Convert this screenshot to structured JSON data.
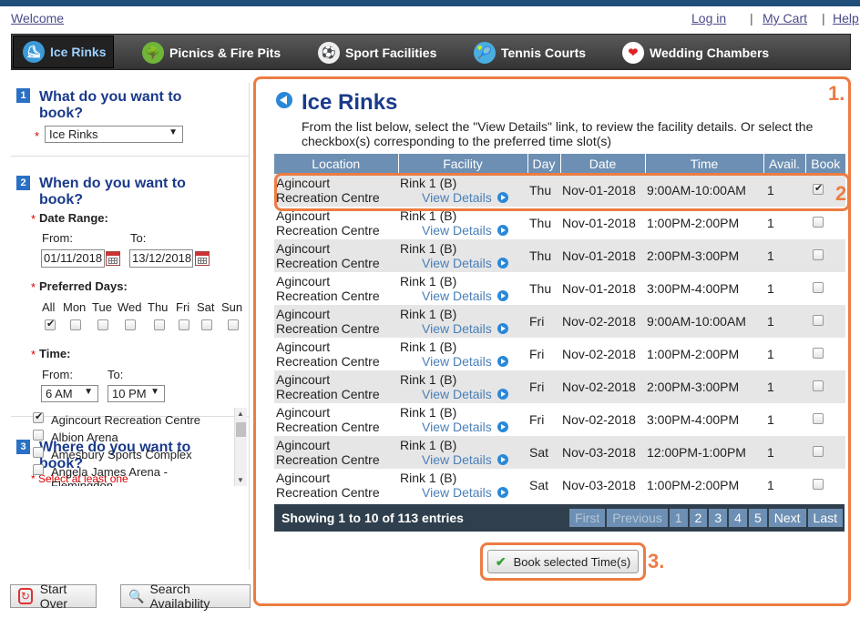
{
  "header": {
    "welcome": "Welcome",
    "login": "Log in",
    "cart": "My Cart",
    "help": "Help",
    "sep": "|"
  },
  "nav": {
    "tabs": [
      {
        "label": "Ice Rinks",
        "icon": "skate-icon",
        "active": true
      },
      {
        "label": "Picnics & Fire Pits",
        "icon": "picnic-icon"
      },
      {
        "label": "Sport Facilities",
        "icon": "soccer-ball-icon"
      },
      {
        "label": "Tennis Courts",
        "icon": "tennis-icon"
      },
      {
        "label": "Wedding Chambers",
        "icon": "heart-icon"
      }
    ]
  },
  "sidebar": {
    "step1": {
      "num": "1",
      "title": "What do you want to book?",
      "req": "*",
      "selected": "Ice Rinks"
    },
    "step2": {
      "num": "2",
      "title": "When do you want to book?",
      "date_range_label": "Date Range:",
      "from_label": "From:",
      "to_label": "To:",
      "from_value": "01/11/2018",
      "to_value": "13/12/2018",
      "days_label": "Preferred Days:",
      "days": [
        "All",
        "Mon",
        "Tue",
        "Wed",
        "Thu",
        "Fri",
        "Sat",
        "Sun"
      ],
      "days_checked": [
        true,
        false,
        false,
        false,
        false,
        false,
        false,
        false
      ],
      "time_label": "Time:",
      "time_from_label": "From:",
      "time_to_label": "To:",
      "time_from": "6 AM",
      "time_to": "10 PM",
      "req": "*"
    },
    "step3": {
      "num": "3",
      "title": "Where do you want to book?",
      "hint": "* Select at least one",
      "venues": [
        {
          "name": "Agincourt Recreation Centre",
          "checked": true
        },
        {
          "name": "Albion Arena",
          "checked": false
        },
        {
          "name": "Amesbury Sports Complex",
          "checked": false
        },
        {
          "name": "Angela James Arena - Flemingdon",
          "checked": false
        }
      ]
    },
    "start_over": "Start Over",
    "search": "Search Availability"
  },
  "main": {
    "title": "Ice Rinks",
    "intro": "From the list below, select the \"View Details\" link, to review the facility details. Or select the checkbox(s) corresponding to the preferred time slot(s)",
    "columns": [
      "Location",
      "Facility",
      "Day",
      "Date",
      "Time",
      "Avail.",
      "Book"
    ],
    "view_details": "View Details",
    "rows": [
      {
        "loc1": "Agincourt",
        "loc2": "Recreation Centre",
        "facility": "Rink 1 (B)",
        "day": "Thu",
        "date": "Nov-01-2018",
        "time": "9:00AM-10:00AM",
        "avail": "1",
        "book": true
      },
      {
        "loc1": "Agincourt",
        "loc2": "Recreation Centre",
        "facility": "Rink 1 (B)",
        "day": "Thu",
        "date": "Nov-01-2018",
        "time": "1:00PM-2:00PM",
        "avail": "1",
        "book": false
      },
      {
        "loc1": "Agincourt",
        "loc2": "Recreation Centre",
        "facility": "Rink 1 (B)",
        "day": "Thu",
        "date": "Nov-01-2018",
        "time": "2:00PM-3:00PM",
        "avail": "1",
        "book": false
      },
      {
        "loc1": "Agincourt",
        "loc2": "Recreation Centre",
        "facility": "Rink 1 (B)",
        "day": "Thu",
        "date": "Nov-01-2018",
        "time": "3:00PM-4:00PM",
        "avail": "1",
        "book": false
      },
      {
        "loc1": "Agincourt",
        "loc2": "Recreation Centre",
        "facility": "Rink 1 (B)",
        "day": "Fri",
        "date": "Nov-02-2018",
        "time": "9:00AM-10:00AM",
        "avail": "1",
        "book": false
      },
      {
        "loc1": "Agincourt",
        "loc2": "Recreation Centre",
        "facility": "Rink 1 (B)",
        "day": "Fri",
        "date": "Nov-02-2018",
        "time": "1:00PM-2:00PM",
        "avail": "1",
        "book": false
      },
      {
        "loc1": "Agincourt",
        "loc2": "Recreation Centre",
        "facility": "Rink 1 (B)",
        "day": "Fri",
        "date": "Nov-02-2018",
        "time": "2:00PM-3:00PM",
        "avail": "1",
        "book": false
      },
      {
        "loc1": "Agincourt",
        "loc2": "Recreation Centre",
        "facility": "Rink 1 (B)",
        "day": "Fri",
        "date": "Nov-02-2018",
        "time": "3:00PM-4:00PM",
        "avail": "1",
        "book": false
      },
      {
        "loc1": "Agincourt",
        "loc2": "Recreation Centre",
        "facility": "Rink 1 (B)",
        "day": "Sat",
        "date": "Nov-03-2018",
        "time": "12:00PM-1:00PM",
        "avail": "1",
        "book": false
      },
      {
        "loc1": "Agincourt",
        "loc2": "Recreation Centre",
        "facility": "Rink 1 (B)",
        "day": "Sat",
        "date": "Nov-03-2018",
        "time": "1:00PM-2:00PM",
        "avail": "1",
        "book": false
      }
    ],
    "showing": "Showing 1 to 10 of 113 entries",
    "pager": [
      "First",
      "Previous",
      "1",
      "2",
      "3",
      "4",
      "5",
      "Next",
      "Last"
    ],
    "book_button": "Book selected Time(s)",
    "annotations": [
      "1.",
      "2.",
      "3."
    ]
  },
  "colors": {
    "accent": "#1a3a8a",
    "highlight": "#ec7c43",
    "table_header": "#6d8fb3",
    "pager_bg": "#2f3f4d"
  }
}
